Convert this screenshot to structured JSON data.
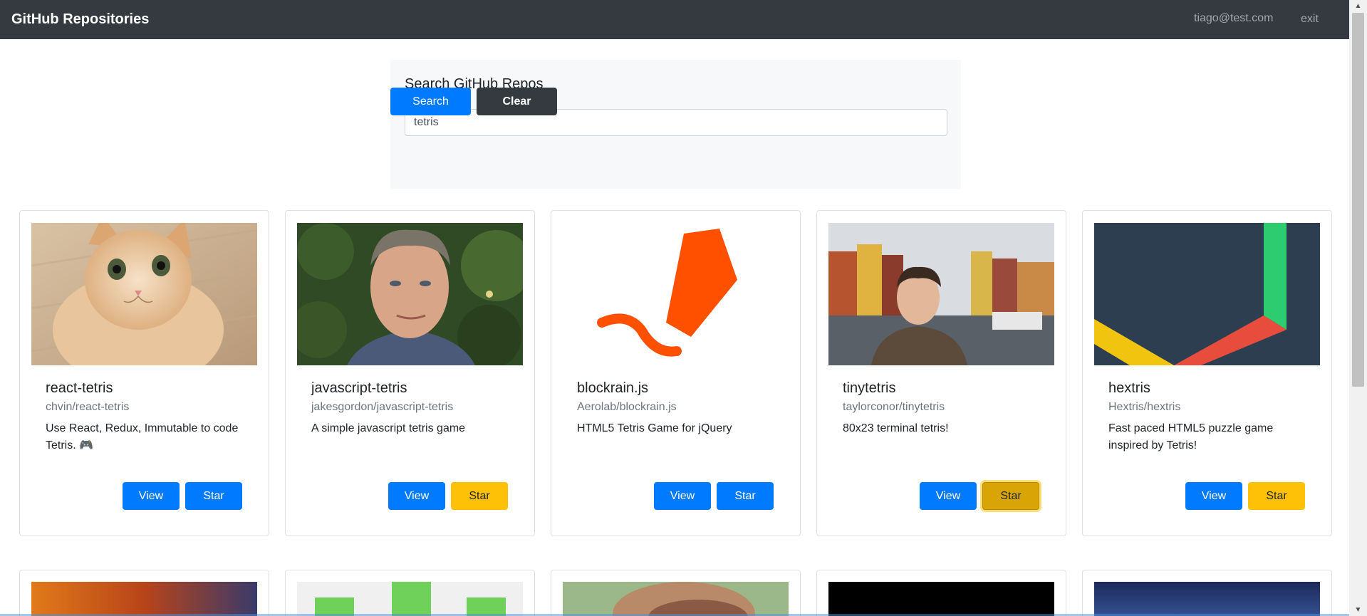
{
  "navbar": {
    "brand": "GitHub Repositories",
    "user": "tiago@test.com",
    "exit": "exit"
  },
  "search": {
    "title": "Search GitHub Repos",
    "value": "tetris",
    "search_label": "Search",
    "clear_label": "Clear"
  },
  "repos": [
    {
      "name": "react-tetris",
      "full_name": "chvin/react-tetris",
      "description": "Use React, Redux, Immutable to code Tetris. 🎮",
      "view_label": "View",
      "star_label": "Star",
      "star_state": "unstarred"
    },
    {
      "name": "javascript-tetris",
      "full_name": "jakesgordon/javascript-tetris",
      "description": "A simple javascript tetris game",
      "view_label": "View",
      "star_label": "Star",
      "star_state": "starred"
    },
    {
      "name": "blockrain.js",
      "full_name": "Aerolab/blockrain.js",
      "description": "HTML5 Tetris Game for jQuery",
      "view_label": "View",
      "star_label": "Star",
      "star_state": "unstarred"
    },
    {
      "name": "tinytetris",
      "full_name": "taylorconor/tinytetris",
      "description": "80x23 terminal tetris!",
      "view_label": "View",
      "star_label": "Star",
      "star_state": "starred-focused"
    },
    {
      "name": "hextris",
      "full_name": "Hextris/hextris",
      "description": "Fast paced HTML5 puzzle game inspired by Tetris!",
      "view_label": "View",
      "star_label": "Star",
      "star_state": "starred"
    }
  ],
  "colors": {
    "primary": "#007bff",
    "dark": "#343a40",
    "warning": "#ffc107",
    "muted": "#6c757d"
  },
  "icons": {
    "scroll_up": "triangle-up-icon",
    "scroll_down": "triangle-down-icon"
  }
}
